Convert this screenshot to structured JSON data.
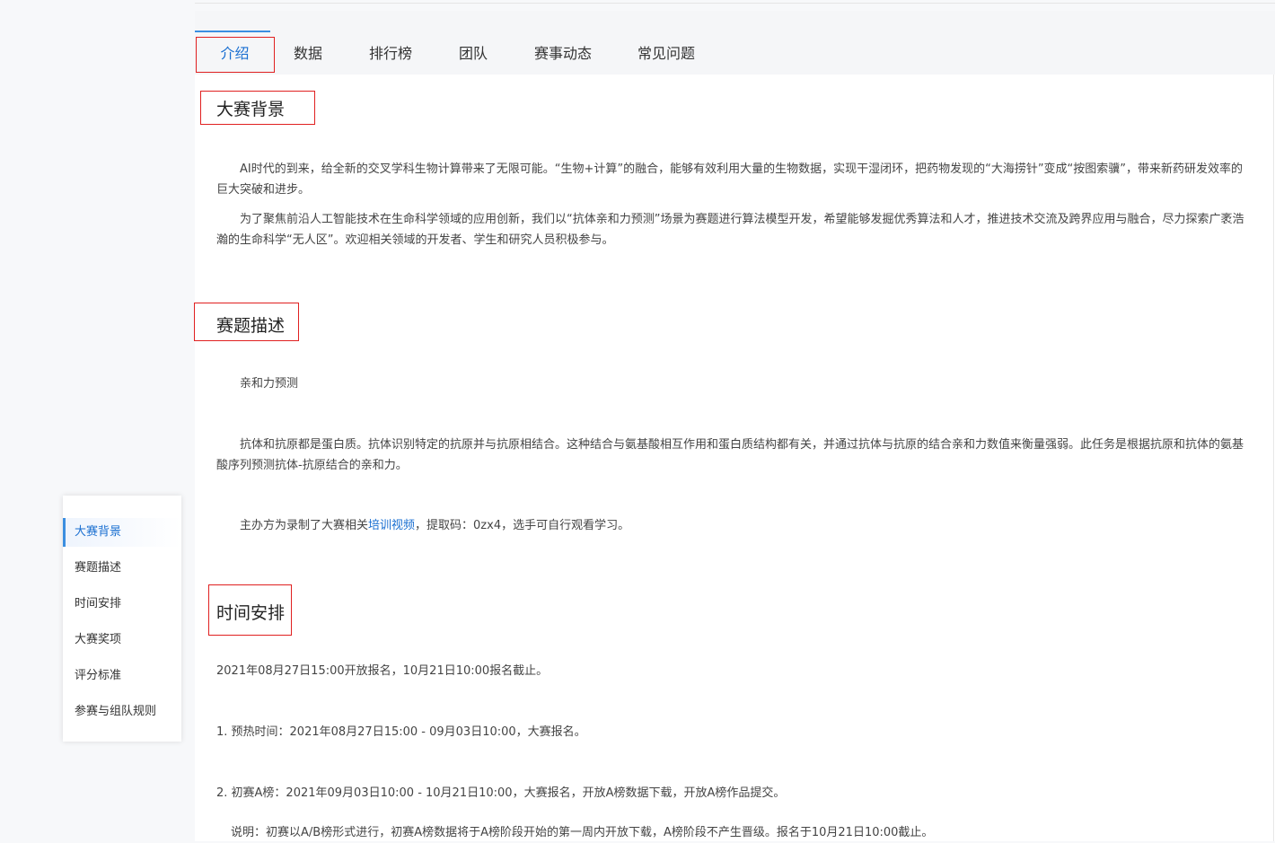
{
  "tabs": [
    {
      "label": "介绍",
      "active": true
    },
    {
      "label": "数据",
      "active": false
    },
    {
      "label": "排行榜",
      "active": false
    },
    {
      "label": "团队",
      "active": false
    },
    {
      "label": "赛事动态",
      "active": false
    },
    {
      "label": "常见问题",
      "active": false
    }
  ],
  "sections": {
    "background": {
      "title": "大赛背景",
      "p1": "AI时代的到来，给全新的交叉学科生物计算带来了无限可能。“生物+计算”的融合，能够有效利用大量的生物数据，实现干湿闭环，把药物发现的“大海捞针”变成“按图索骥”，带来新药研发效率的巨大突破和进步。",
      "p2": "为了聚焦前沿人工智能技术在生命科学领域的应用创新，我们以“抗体亲和力预测”场景为赛题进行算法模型开发，希望能够发掘优秀算法和人才，推进技术交流及跨界应用与融合，尽力探索广袤浩瀚的生命科学“无人区”。欢迎相关领域的开发者、学生和研究人员积极参与。"
    },
    "description": {
      "title": "赛题描述",
      "p1": "亲和力预测",
      "p2": "抗体和抗原都是蛋白质。抗体识别特定的抗原并与抗原相结合。这种结合与氨基酸相互作用和蛋白质结构都有关，并通过抗体与抗原的结合亲和力数值来衡量强弱。此任务是根据抗原和抗体的氨基酸序列预测抗体-抗原结合的亲和力。",
      "p3_prefix": "主办方为录制了大赛相关",
      "p3_link": "培训视频",
      "p3_suffix": "，提取码：0zx4，选手可自行观看学习。"
    },
    "schedule": {
      "title": "时间安排",
      "p1": "2021年08月27日15:00开放报名，10月21日10:00报名截止。",
      "p2": "1. 预热时间：2021年08月27日15:00 - 09月03日10:00，大赛报名。",
      "p3": "2. 初赛A榜：2021年09月03日10:00 - 10月21日10:00，大赛报名，开放A榜数据下载，开放A榜作品提交。",
      "p4": "说明：初赛以A/B榜形式进行，初赛A榜数据将于A榜阶段开始的第一周内开放下载，A榜阶段不产生晋级。报名于10月21日10:00截止。"
    }
  },
  "sidenav": {
    "items": [
      {
        "label": "大赛背景",
        "active": true
      },
      {
        "label": "赛题描述",
        "active": false
      },
      {
        "label": "时间安排",
        "active": false
      },
      {
        "label": "大赛奖项",
        "active": false
      },
      {
        "label": "评分标准",
        "active": false
      },
      {
        "label": "参赛与组队规则",
        "active": false
      }
    ]
  },
  "colors": {
    "accent": "#1a6fd1",
    "highlight_box": "#e02020"
  }
}
